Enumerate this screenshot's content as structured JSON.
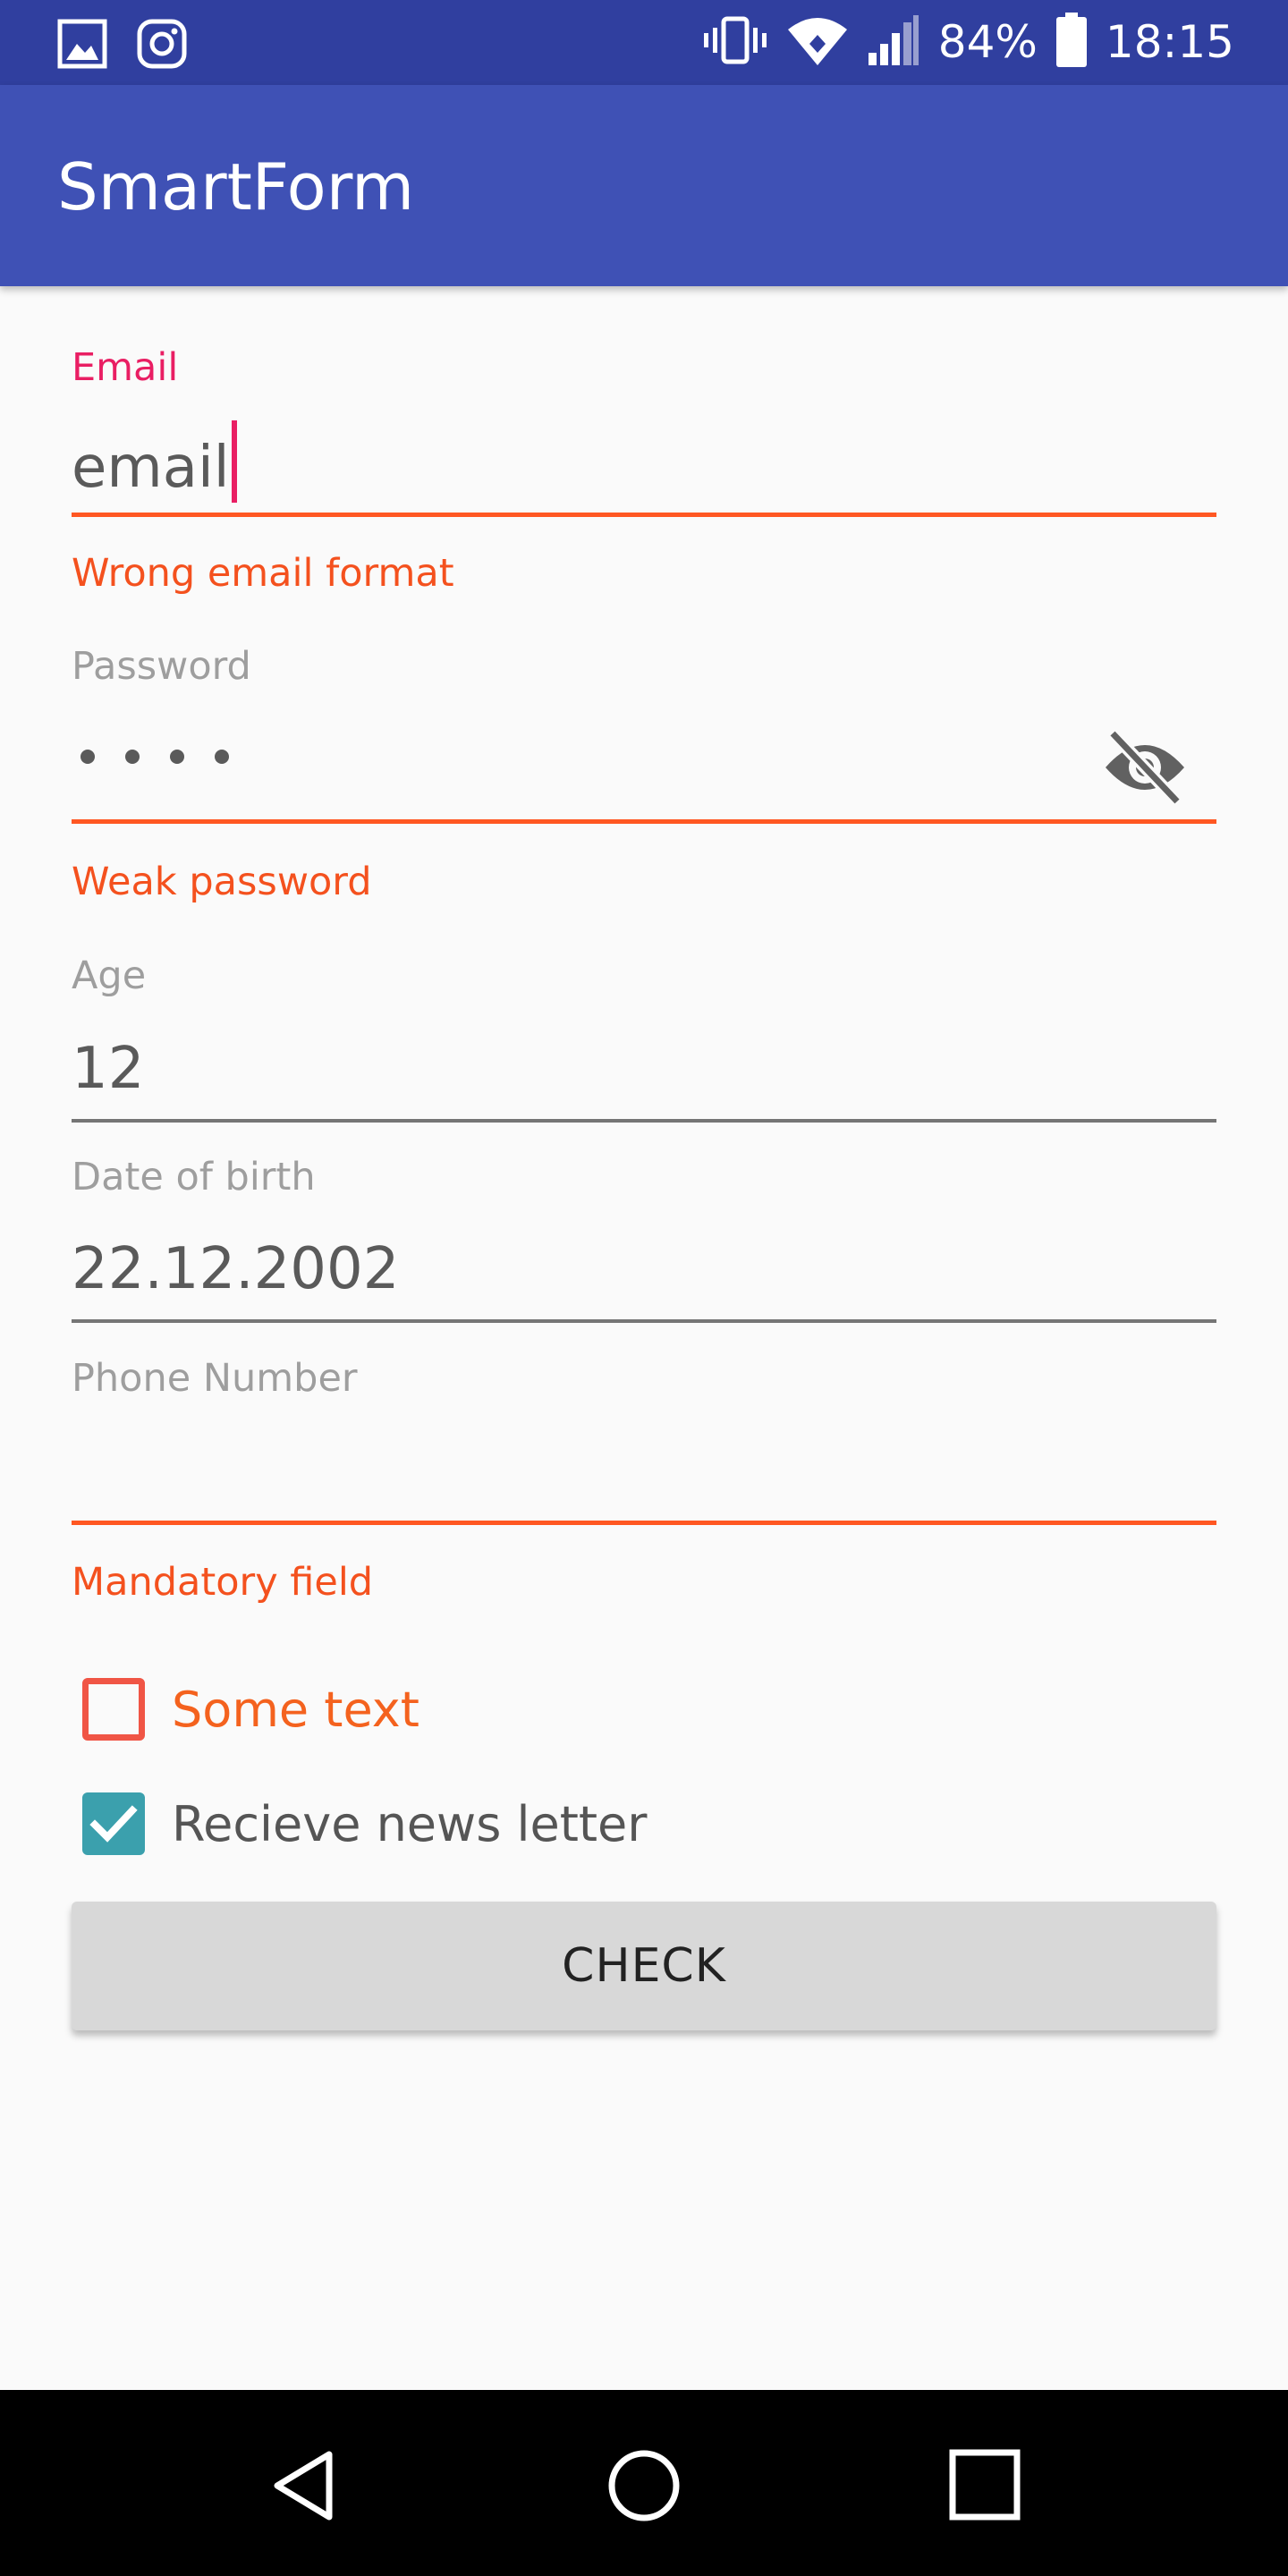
{
  "status_bar": {
    "left_icons": [
      "gallery-icon",
      "instagram-icon"
    ],
    "right_icons": [
      "vibrate-icon",
      "wifi-icon",
      "signal-icon",
      "battery-icon"
    ],
    "battery_percent": "84%",
    "time": "18:15"
  },
  "app_bar": {
    "title": "SmartForm",
    "color": "#3f51b5",
    "status_color": "#303f9f"
  },
  "form": {
    "email": {
      "label": "Email",
      "value": "email",
      "error": "Wrong email format"
    },
    "password": {
      "label": "Password",
      "masked_length": 4,
      "toggle_icon": "visibility-off-icon",
      "error": "Weak password"
    },
    "age": {
      "label": "Age",
      "value": "12"
    },
    "dob": {
      "label": "Date of birth",
      "value": "22.12.2002"
    },
    "phone": {
      "label": "Phone Number",
      "value": "",
      "error": "Mandatory field"
    },
    "checkbox_some_text": {
      "label": "Some text",
      "checked": false
    },
    "checkbox_newsletter": {
      "label": "Recieve news letter",
      "checked": true
    },
    "check_button": "CHECK"
  },
  "colors": {
    "accent": "#e91e63",
    "error": "#ff5722",
    "checkbox_checked": "#3ba0ad"
  },
  "nav_bar": {
    "buttons": [
      "back-icon",
      "home-icon",
      "recents-icon"
    ]
  }
}
